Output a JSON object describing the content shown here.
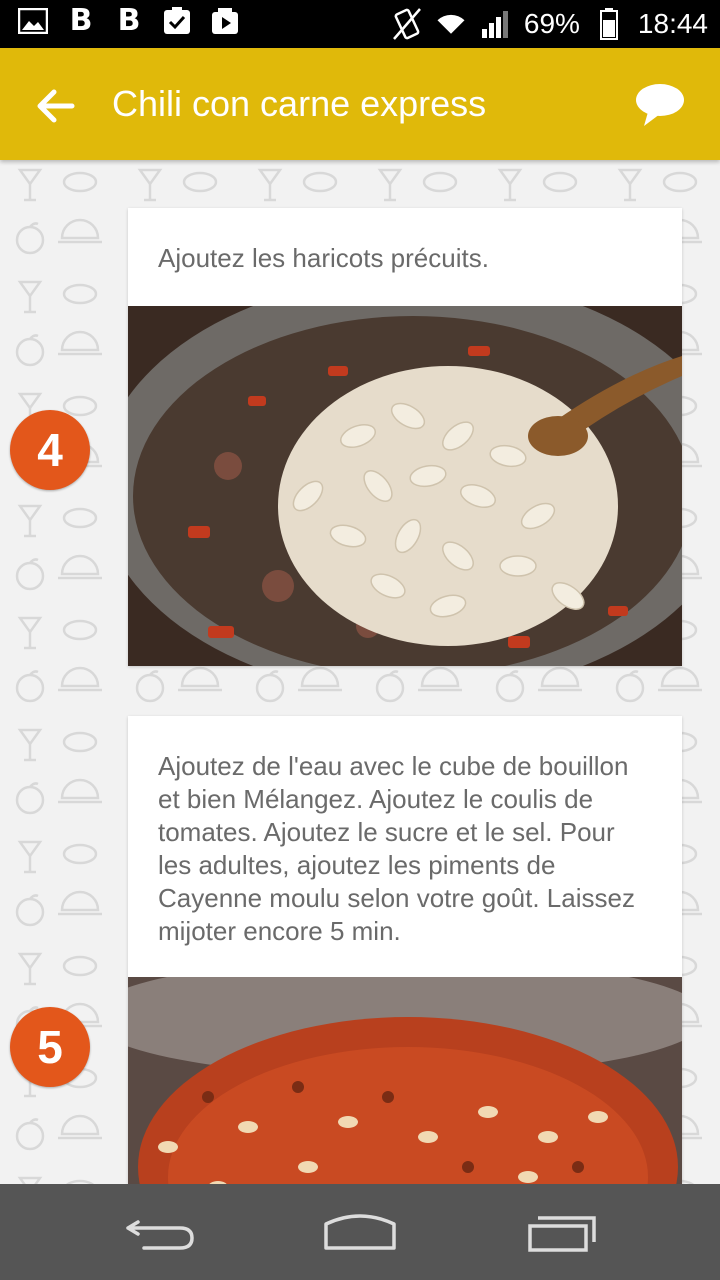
{
  "status_bar": {
    "battery": "69%",
    "time": "18:44",
    "letter_icons": [
      "B",
      "B"
    ],
    "icons": [
      "gallery-icon",
      "beats-icon",
      "beats-icon",
      "task-icon",
      "play-icon",
      "vibrate-icon",
      "wifi-icon",
      "signal-icon",
      "battery-icon"
    ]
  },
  "app_bar": {
    "title": "Chili con carne express",
    "accent_color": "#e0b90a"
  },
  "steps": [
    {
      "number": "4",
      "text": "Ajoutez les haricots précuits."
    },
    {
      "number": "5",
      "text": "Ajoutez de l'eau avec le cube de bouillon et bien Mélangez. Ajoutez le coulis de tomates. Ajoutez le sucre et le sel. Pour les adultes, ajoutez les piments de Cayenne moulu selon votre goût. Laissez mijoter encore 5 min."
    }
  ],
  "badge_color": "#e3571b",
  "nav_bar": {
    "buttons": [
      "back",
      "home",
      "recents"
    ]
  }
}
